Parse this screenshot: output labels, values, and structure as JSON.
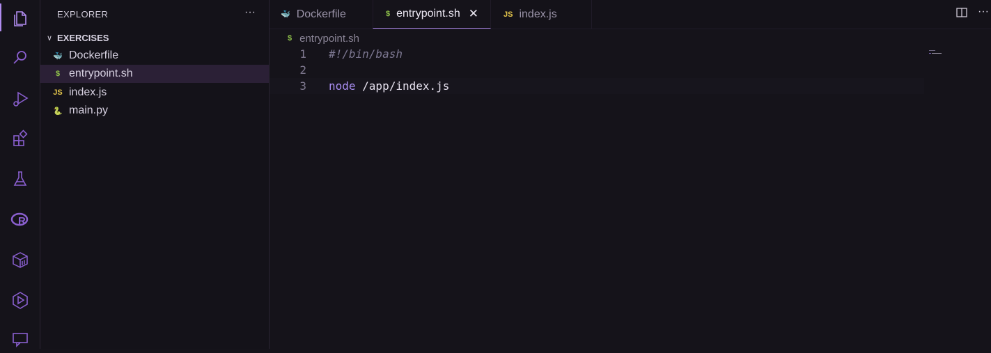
{
  "activity_bar": {
    "items": [
      {
        "icon": "files-icon"
      },
      {
        "icon": "search-icon"
      },
      {
        "icon": "run-debug-icon"
      },
      {
        "icon": "extensions-icon"
      },
      {
        "icon": "testing-flask-icon"
      },
      {
        "icon": "r-language-icon"
      },
      {
        "icon": "container-box-icon"
      },
      {
        "icon": "play-hexagon-icon"
      },
      {
        "icon": "chat-icon"
      }
    ]
  },
  "sidebar": {
    "title": "EXPLORER",
    "more": "···",
    "folder": {
      "chevron": "∨",
      "name": "EXERCISES"
    },
    "files": [
      {
        "icon": "docker-icon",
        "icon_text": "🐳",
        "icon_color": "#5fa5d6",
        "name": "Dockerfile"
      },
      {
        "icon": "shell-icon",
        "icon_text": "$",
        "icon_color": "#8fc14a",
        "name": "entrypoint.sh"
      },
      {
        "icon": "javascript-icon",
        "icon_text": "JS",
        "icon_color": "#e3c54b",
        "name": "index.js"
      },
      {
        "icon": "python-icon",
        "icon_text": "🐍",
        "icon_color": "#4f8fc9",
        "name": "main.py"
      }
    ],
    "selected": "entrypoint.sh"
  },
  "tabs": [
    {
      "icon": "docker-icon",
      "icon_text": "🐳",
      "label": "Dockerfile",
      "active": false
    },
    {
      "icon": "shell-icon",
      "icon_text": "$",
      "label": "entrypoint.sh",
      "active": true,
      "close": "✕"
    },
    {
      "icon": "javascript-icon",
      "icon_text": "JS",
      "label": "index.js",
      "active": false
    }
  ],
  "toolbar": {
    "more": "···"
  },
  "breadcrumb": {
    "icon_text": "$",
    "file": "entrypoint.sh"
  },
  "editor": {
    "lines": [
      {
        "num": "1",
        "text": "#!/bin/bash"
      },
      {
        "num": "2",
        "text": ""
      },
      {
        "num": "3",
        "kw": "node",
        "rest": " /app/index.js"
      }
    ]
  },
  "colors": {
    "accent": "#b18cf0",
    "background": "#15131a"
  }
}
